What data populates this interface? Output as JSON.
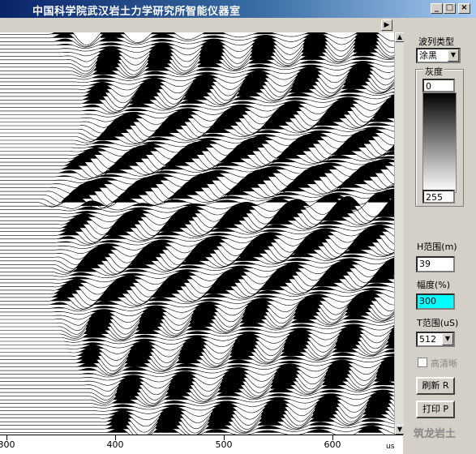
{
  "window": {
    "title": "中国科学院武汉岩土力学研究所智能仪器室"
  },
  "panel": {
    "wave_type_label": "波列类型",
    "wave_type_value": "涂黑",
    "gray_label": "灰度",
    "gray_min": "0",
    "gray_max": "255",
    "h_range_label": "H范围(m)",
    "h_range_value": "39",
    "amplitude_label": "幅度(%)",
    "amplitude_value": "300",
    "t_range_label": "T范围(uS)",
    "t_range_value": "512",
    "hd_label": "高清晰",
    "refresh_label": "刷新 R",
    "print_label": "打印 P"
  },
  "axis": {
    "labels": [
      "300",
      "400",
      "500",
      "600"
    ],
    "unit": "us"
  },
  "watermark": "筑龙岩土"
}
